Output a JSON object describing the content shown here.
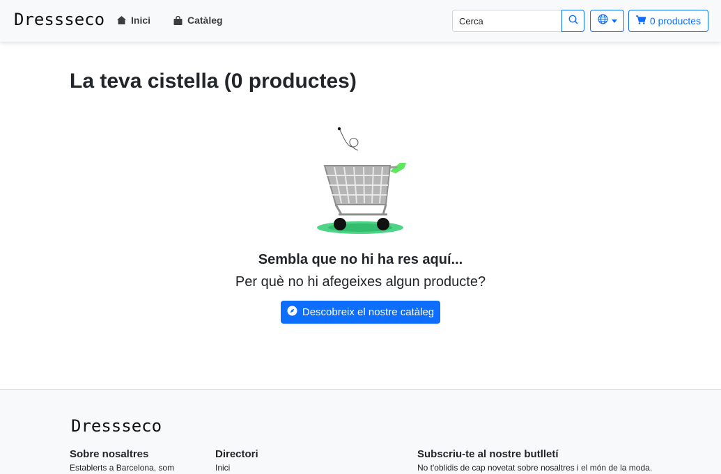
{
  "header": {
    "brand": "Dressseco",
    "nav": [
      {
        "label": "Inici",
        "icon": "home-icon"
      },
      {
        "label": "Catàleg",
        "icon": "shopping-bag-icon"
      }
    ],
    "search": {
      "placeholder": "Cerca",
      "value": ""
    },
    "language_icon": "globe-icon",
    "cart_label": "0 productes"
  },
  "main": {
    "title": "La teva cistella (0 productes)",
    "empty_title": "Sembla que no hi ha res aquí...",
    "empty_subtitle": "Per què no hi afegeixes algun producte?",
    "cta_label": "Descobreix el nostre catàleg",
    "cta_icon": "compass-icon"
  },
  "footer": {
    "brand": "Dressseco",
    "columns": [
      {
        "title": "Sobre nosaltres",
        "text": "Establerts a Barcelona, som"
      },
      {
        "title": "Directori",
        "text": "Inici"
      },
      {
        "title": "Subscriu-te al nostre butlletí",
        "text": "No t'oblidis de cap novetat sobre nosaltres i el món de la moda."
      }
    ]
  },
  "colors": {
    "primary": "#0d6efd",
    "navbar_bg": "#f8f9fa",
    "accent_green": "#4cd964"
  }
}
